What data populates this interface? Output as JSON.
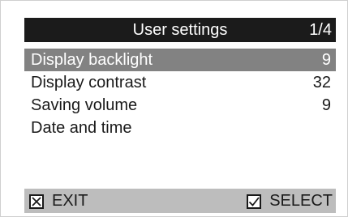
{
  "header": {
    "title": "User settings",
    "page": "1/4"
  },
  "menu": {
    "items": [
      {
        "label": "Display backlight",
        "value": "9",
        "selected": true
      },
      {
        "label": "Display contrast",
        "value": "32",
        "selected": false
      },
      {
        "label": "Saving volume",
        "value": "9",
        "selected": false
      },
      {
        "label": "Date and time",
        "value": "",
        "selected": false
      }
    ]
  },
  "footer": {
    "exit_label": "EXIT",
    "select_label": "SELECT"
  },
  "icons": {
    "exit": "x-box-icon",
    "select": "checkmark-box-icon"
  },
  "colors": {
    "header_bg": "#1b1b1b",
    "selected_bg": "#828282",
    "footer_bg": "#bdbdbd"
  }
}
